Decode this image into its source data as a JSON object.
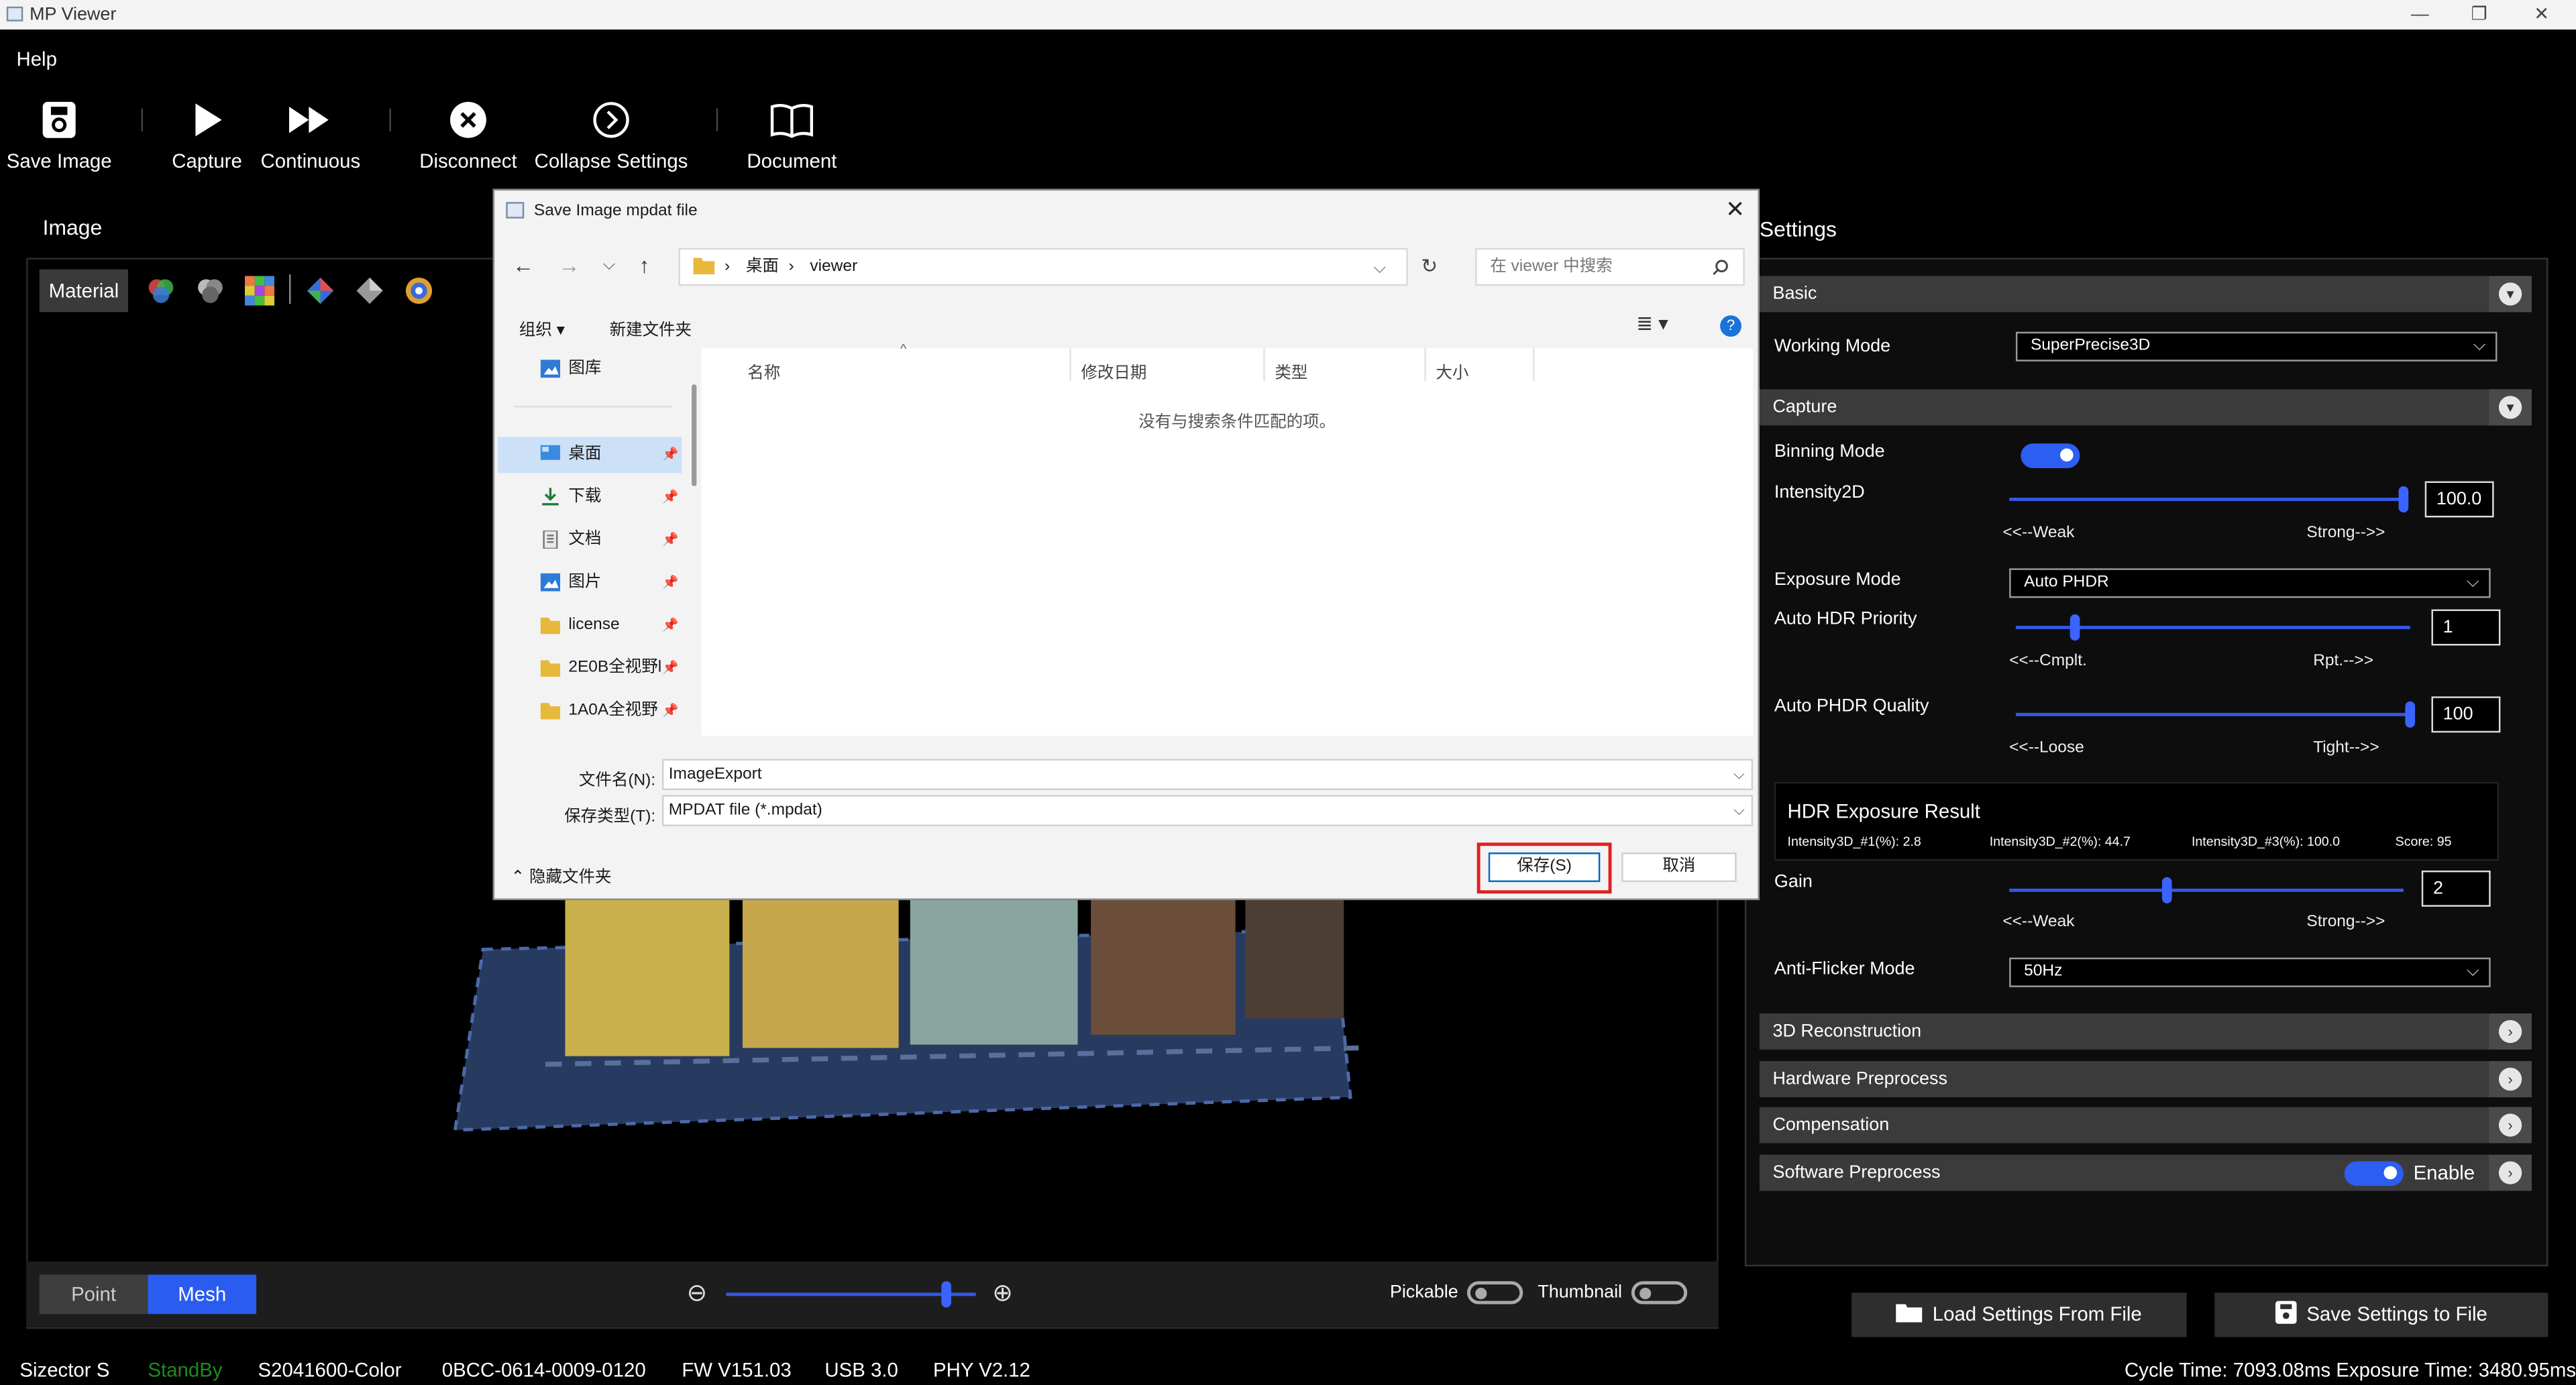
{
  "window": {
    "title": "MP Viewer",
    "minimize": "—",
    "maximize": "❐",
    "close": "✕"
  },
  "menu": {
    "help": "Help"
  },
  "toolbar": {
    "save_image": "Save Image",
    "capture": "Capture",
    "continuous": "Continuous",
    "disconnect": "Disconnect",
    "collapse_settings": "Collapse Settings",
    "document": "Document"
  },
  "image_panel": {
    "title": "Image",
    "material": "Material",
    "point": "Point",
    "mesh": "Mesh",
    "pickable": "Pickable",
    "thumbnail": "Thumbnail",
    "zoom_out": "⊖",
    "zoom_in": "⊕",
    "zoom_level": 0.88
  },
  "settings": {
    "title": "Settings",
    "basic": "Basic",
    "working_mode_label": "Working Mode",
    "working_mode_value": "SuperPrecise3D",
    "capture": "Capture",
    "binning_mode_label": "Binning Mode",
    "intensity2d_label": "Intensity2D",
    "intensity2d_value": "100.0",
    "intensity2d_level": 1.0,
    "weak": "<<--Weak",
    "strong": "Strong-->>",
    "exposure_mode_label": "Exposure Mode",
    "exposure_mode_value": "Auto PHDR",
    "auto_hdr_priority_label": "Auto HDR Priority",
    "auto_hdr_priority_value": "1",
    "auto_hdr_priority_level": 0.15,
    "cmplt": "<<--Cmplt.",
    "rpt": "Rpt.-->>",
    "auto_phdr_quality_label": "Auto PHDR Quality",
    "auto_phdr_quality_value": "100",
    "auto_phdr_quality_level": 1.0,
    "loose": "<<--Loose",
    "tight": "Tight-->>",
    "hdr_result_title": "HDR Exposure Result",
    "hdr_i1": "Intensity3D_#1(%): 2.8",
    "hdr_i2": "Intensity3D_#2(%): 44.7",
    "hdr_i3": "Intensity3D_#3(%): 100.0",
    "hdr_score": "Score: 95",
    "gain_label": "Gain",
    "gain_value": "2",
    "gain_level": 0.4,
    "anti_flicker_label": "Anti-Flicker Mode",
    "anti_flicker_value": "50Hz",
    "reconstruction": "3D Reconstruction",
    "hardware_preprocess": "Hardware Preprocess",
    "compensation": "Compensation",
    "software_preprocess": "Software Preprocess",
    "enable": "Enable",
    "load_settings": "Load Settings From File",
    "save_settings": "Save Settings to File"
  },
  "status": {
    "device": "Sizector S",
    "state": "StandBy",
    "model": "S2041600-Color",
    "serial": "0BCC-0614-0009-0120",
    "fw": "FW V151.03",
    "usb": "USB 3.0",
    "phy": "PHY V2.12",
    "timing": "Cycle Time: 7093.08ms Exposure Time: 3480.95ms",
    "state_color": "#1f8a1f"
  },
  "dialog": {
    "title": "Save Image mpdat file",
    "path_desktop": "桌面",
    "path_viewer": "viewer",
    "search_placeholder": "在 viewer 中搜索",
    "organize": "组织 ▾",
    "new_folder": "新建文件夹",
    "nav": {
      "gallery": "图库",
      "desktop": "桌面",
      "downloads": "下载",
      "documents": "文档",
      "pictures": "图片",
      "license": "license",
      "folder1": "2E0B全视野l",
      "folder2": "1A0A全视野"
    },
    "col_name": "名称",
    "col_modified": "修改日期",
    "col_type": "类型",
    "col_size": "大小",
    "empty": "没有与搜索条件匹配的项。",
    "filename_label": "文件名(N):",
    "filename_value": "ImageExport",
    "filetype_label": "保存类型(T):",
    "filetype_value": "MPDAT file (*.mpdat)",
    "hide_folders": "隐藏文件夹",
    "save": "保存(S)",
    "cancel": "取消"
  },
  "colors": {
    "accent": "#2b5cf0",
    "highlight": "#e02020"
  }
}
